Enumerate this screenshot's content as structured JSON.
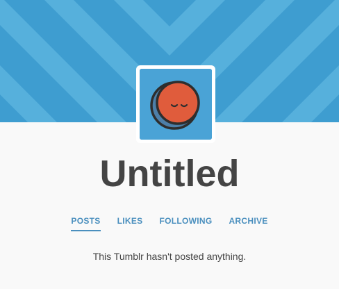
{
  "colors": {
    "header_bg": "#3e9dd0",
    "header_stripe": "#56b0dc",
    "page_bg": "#f9f9f9",
    "avatar_bg": "#4aa3d6",
    "avatar_face": "#e05c3c",
    "avatar_outline": "#2e2e2e",
    "avatar_shadow": "#4d7fa8",
    "title_color": "#444444",
    "nav_color": "#4a8fbe"
  },
  "header": {
    "pattern": "diagonal-stripes-chevron"
  },
  "avatar": {
    "icon": "sleeping-face-icon"
  },
  "blog": {
    "title": "Untitled"
  },
  "nav": {
    "items": [
      {
        "label": "POSTS",
        "active": true
      },
      {
        "label": "LIKES",
        "active": false
      },
      {
        "label": "FOLLOWING",
        "active": false
      },
      {
        "label": "ARCHIVE",
        "active": false
      }
    ]
  },
  "main": {
    "empty_message": "This Tumblr hasn't posted anything."
  }
}
